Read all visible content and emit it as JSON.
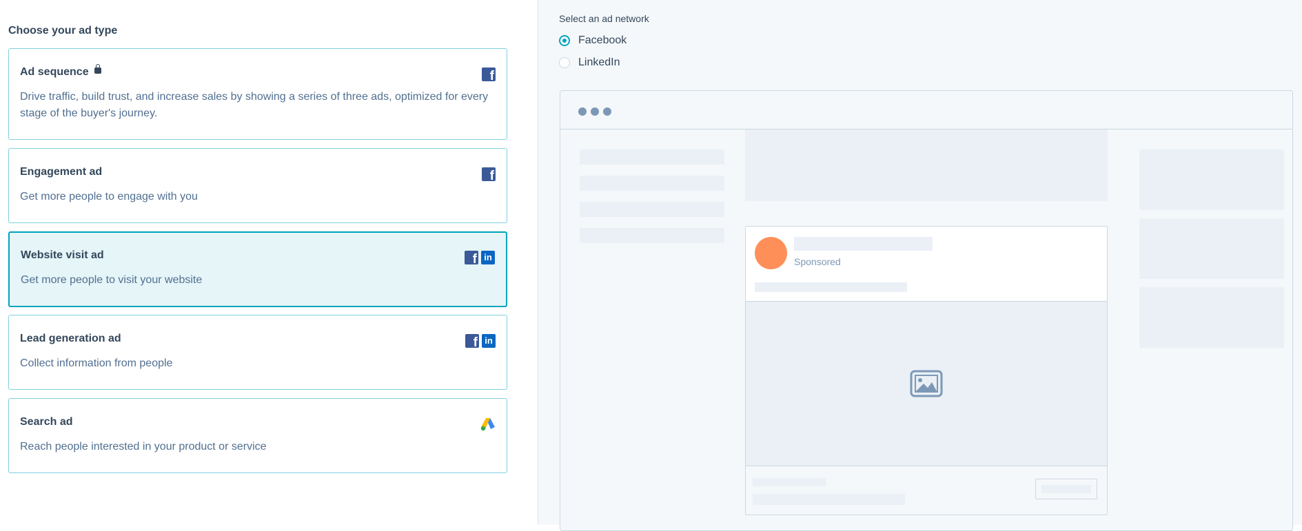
{
  "left_panel": {
    "title": "Choose your ad type",
    "cards": [
      {
        "title": "Ad sequence",
        "locked": true,
        "description": "Drive traffic, build trust, and increase sales by showing a series of three ads, optimized for every stage of the buyer's journey.",
        "networks": [
          "facebook-icon"
        ],
        "selected": false
      },
      {
        "title": "Engagement ad",
        "description": "Get more people to engage with you",
        "networks": [
          "facebook-icon"
        ],
        "selected": false
      },
      {
        "title": "Website visit ad",
        "description": "Get more people to visit your website",
        "networks": [
          "facebook-icon",
          "linkedin-icon"
        ],
        "selected": true
      },
      {
        "title": "Lead generation ad",
        "description": "Collect information from people",
        "networks": [
          "facebook-icon",
          "linkedin-icon"
        ],
        "selected": false
      },
      {
        "title": "Search ad",
        "description": "Reach people interested in your product or service",
        "networks": [
          "google-ads-icon"
        ],
        "selected": false
      }
    ]
  },
  "right_panel": {
    "network_label": "Select an ad network",
    "networks": [
      {
        "label": "Facebook",
        "checked": true
      },
      {
        "label": "LinkedIn",
        "checked": false
      }
    ],
    "preview": {
      "sponsored_label": "Sponsored",
      "icons": [
        "window-dots-icon",
        "image-placeholder-icon"
      ]
    }
  },
  "colors": {
    "accent": "#00a4bd",
    "selected_bg": "#e5f5f8",
    "card_border": "#7fd1de",
    "text": "#33475b",
    "avatar": "#ff8f59",
    "facebook": "#3b5998",
    "linkedin": "#0a66c2"
  }
}
